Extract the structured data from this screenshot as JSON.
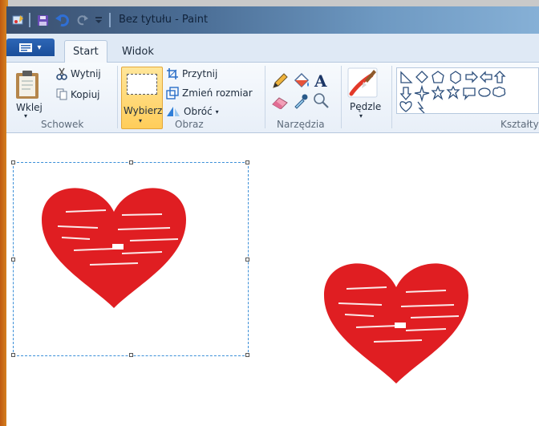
{
  "window": {
    "title": "Bez tytułu - Paint",
    "file_menu_arrow": "▾"
  },
  "quick_access": {
    "icons": [
      "paint-app-icon",
      "save-icon",
      "undo-icon",
      "redo-icon",
      "customize-icon"
    ]
  },
  "tabs": {
    "start": "Start",
    "view": "Widok"
  },
  "ribbon": {
    "clipboard": {
      "paste": "Wklej",
      "cut": "Wytnij",
      "copy": "Kopiuj",
      "group": "Schowek"
    },
    "image": {
      "select": "Wybierz",
      "crop": "Przytnij",
      "resize": "Zmień rozmiar",
      "rotate": "Obróć",
      "group": "Obraz"
    },
    "tools": {
      "group": "Narzędzia",
      "text_tool": "A"
    },
    "brushes": {
      "label": "Pędzle"
    },
    "shapes": {
      "group": "Kształty"
    }
  },
  "colors": {
    "accent_blue": "#1a4e9a",
    "select_highlight": "#ffcd5a",
    "heart_red": "#e01e22",
    "selection_dash": "#3b8fd8"
  }
}
